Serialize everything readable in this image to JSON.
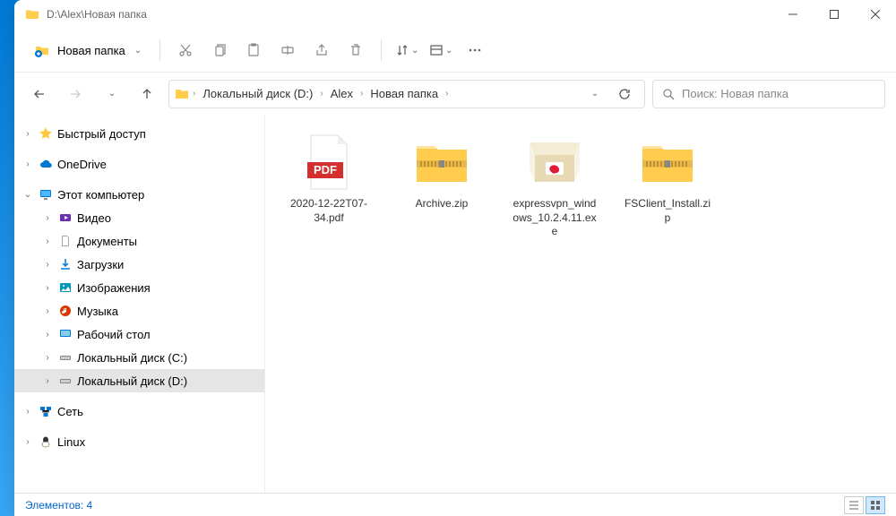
{
  "window": {
    "title": "D:\\Alex\\Новая папка"
  },
  "toolbar": {
    "new_label": "Новая папка"
  },
  "breadcrumbs": [
    "Локальный диск (D:)",
    "Alex",
    "Новая папка"
  ],
  "search": {
    "placeholder": "Поиск: Новая папка"
  },
  "sidebar": {
    "quick": "Быстрый доступ",
    "onedrive": "OneDrive",
    "thispc": "Этот компьютер",
    "pc_items": [
      "Видео",
      "Документы",
      "Загрузки",
      "Изображения",
      "Музыка",
      "Рабочий стол",
      "Локальный диск (C:)",
      "Локальный диск (D:)"
    ],
    "network": "Сеть",
    "linux": "Linux"
  },
  "files": [
    {
      "name": "2020-12-22T07-34.pdf",
      "type": "pdf"
    },
    {
      "name": "Archive.zip",
      "type": "zip"
    },
    {
      "name": "expressvpn_windows_10.2.4.11.exe",
      "type": "exe"
    },
    {
      "name": "FSClient_Install.zip",
      "type": "zip"
    }
  ],
  "status": {
    "count_label": "Элементов: 4"
  }
}
